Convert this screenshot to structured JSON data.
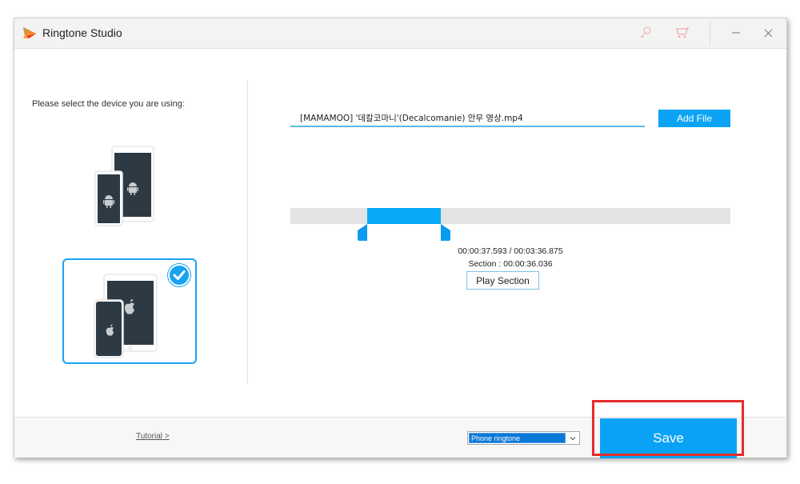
{
  "window": {
    "title": "Ringtone Studio",
    "icons": [
      "key-icon",
      "cart-icon",
      "minimize-icon",
      "close-icon"
    ]
  },
  "left_panel": {
    "prompt": "Please select the device you are using:",
    "devices": [
      {
        "name": "Android",
        "icon": "android-icon",
        "selected": false
      },
      {
        "name": "iOS",
        "icon": "apple-icon",
        "selected": true
      }
    ]
  },
  "file": {
    "filename": "[MAMAMOO] '데칼코마니'(Decalcomanie) 안무 영상.mp4",
    "add_file_label": "Add File"
  },
  "timeline": {
    "selection_start_fraction": 0.174,
    "selection_end_fraction": 0.341,
    "current_time": "00:00:37.593",
    "total_time": "00:03:36.875",
    "time_readout": "00:00:37.593 / 00:03:36.875",
    "section_readout": "Section : 00:00:36.036",
    "play_section_label": "Play Section"
  },
  "footer": {
    "tutorial_label": "Tutorial >",
    "output_type_selected": "Phone ringtone",
    "save_label": "Save"
  },
  "colors": {
    "accent": "#0aa2f5",
    "highlight": "#e52b2b",
    "device_screen": "#2d3a43"
  }
}
